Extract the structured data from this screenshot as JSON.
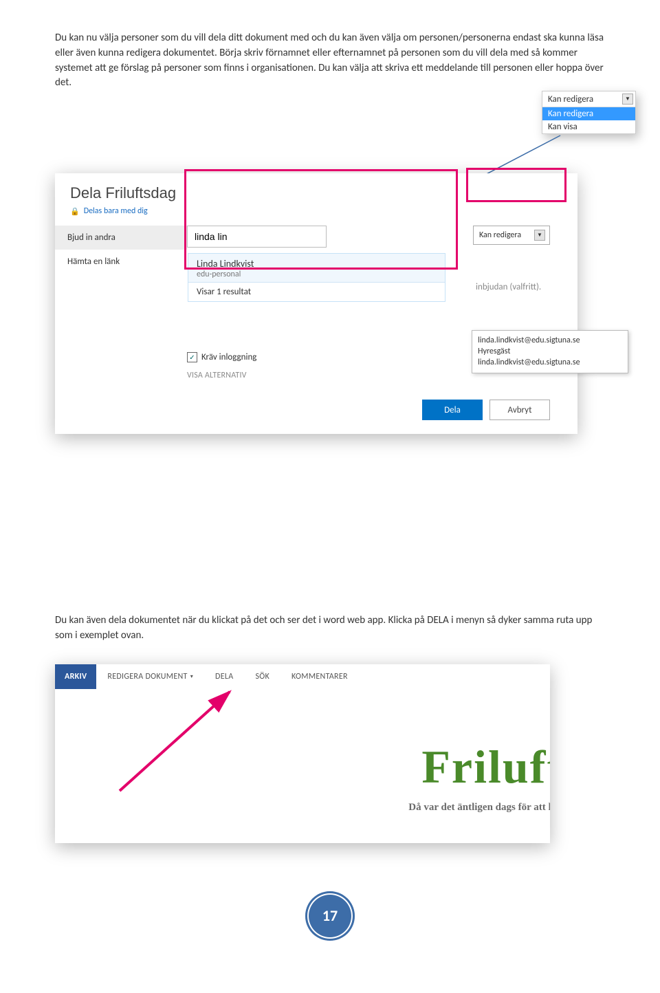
{
  "intro_text": "Du kan nu välja personer som du vill dela ditt dokument med och du kan även välja om personen/personerna endast ska kunna läsa eller även kunna redigera dokumentet. Börja skriv förnamnet eller efternamnet på personen som du vill dela med så kommer systemet att ge förslag på personer som finns i organisationen. Du kan välja att skriva ett meddelande till personen eller hoppa över det.",
  "dialog": {
    "title": "Dela Friluftsdag",
    "shared_with": "Delas bara med dig",
    "left": {
      "invite": "Bjud in andra",
      "getlink": "Hämta en länk"
    },
    "input_value": "linda lin",
    "perm_label": "Kan redigera",
    "suggest": {
      "name": "Linda Lindkvist",
      "org": "edu-personal",
      "count": "Visar 1 resultat"
    },
    "note_placeholder": "inbjudan (valfritt).",
    "tooltip": {
      "line1": "linda.lindkvist@edu.sigtuna.se",
      "line2": "Hyresgäst",
      "line3": "linda.lindkvist@edu.sigtuna.se"
    },
    "require_login": "Kräv inloggning",
    "show_alt": "VISA ALTERNATIV",
    "share_btn": "Dela",
    "cancel_btn": "Avbryt"
  },
  "popout": {
    "head": "Kan redigera",
    "opt1": "Kan redigera",
    "opt2": "Kan visa"
  },
  "midtext": "Du kan även dela dokumentet när du klickat på det och ser det i word web app. Klicka på DELA i menyn så dyker samma ruta upp som i exemplet ovan.",
  "ribbon": {
    "arkiv": "ARKIV",
    "edit": "REDIGERA DOKUMENT",
    "dela": "DELA",
    "sok": "SÖK",
    "komm": "KOMMENTARER"
  },
  "doc": {
    "title": "Friluft",
    "sub": "Då var det äntligen dags för att kor"
  },
  "page_number": "17"
}
